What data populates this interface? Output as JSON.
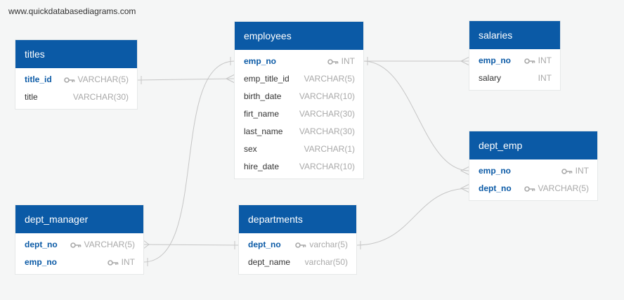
{
  "watermark": "www.quickdatabasediagrams.com",
  "colors": {
    "header": "#0b5aa6",
    "key_field": "#0b5aa6",
    "type_text": "#a9a9a9",
    "line": "#c6c6c6"
  },
  "tables": {
    "titles": {
      "name": "titles",
      "fields": [
        {
          "name": "title_id",
          "type": "VARCHAR(5)",
          "key": true
        },
        {
          "name": "title",
          "type": "VARCHAR(30)",
          "key": false
        }
      ]
    },
    "employees": {
      "name": "employees",
      "fields": [
        {
          "name": "emp_no",
          "type": "INT",
          "key": true
        },
        {
          "name": "emp_title_id",
          "type": "VARCHAR(5)",
          "key": false
        },
        {
          "name": "birth_date",
          "type": "VARCHAR(10)",
          "key": false
        },
        {
          "name": "firt_name",
          "type": "VARCHAR(30)",
          "key": false
        },
        {
          "name": "last_name",
          "type": "VARCHAR(30)",
          "key": false
        },
        {
          "name": "sex",
          "type": "VARCHAR(1)",
          "key": false
        },
        {
          "name": "hire_date",
          "type": "VARCHAR(10)",
          "key": false
        }
      ]
    },
    "salaries": {
      "name": "salaries",
      "fields": [
        {
          "name": "emp_no",
          "type": "INT",
          "key": true
        },
        {
          "name": "salary",
          "type": "INT",
          "key": false
        }
      ]
    },
    "dept_emp": {
      "name": "dept_emp",
      "fields": [
        {
          "name": "emp_no",
          "type": "INT",
          "key": true
        },
        {
          "name": "dept_no",
          "type": "VARCHAR(5)",
          "key": true
        }
      ]
    },
    "dept_manager": {
      "name": "dept_manager",
      "fields": [
        {
          "name": "dept_no",
          "type": "VARCHAR(5)",
          "key": true
        },
        {
          "name": "emp_no",
          "type": "INT",
          "key": true
        }
      ]
    },
    "departments": {
      "name": "departments",
      "fields": [
        {
          "name": "dept_no",
          "type": "varchar(5)",
          "key": true
        },
        {
          "name": "dept_name",
          "type": "varchar(50)",
          "key": false
        }
      ]
    }
  }
}
